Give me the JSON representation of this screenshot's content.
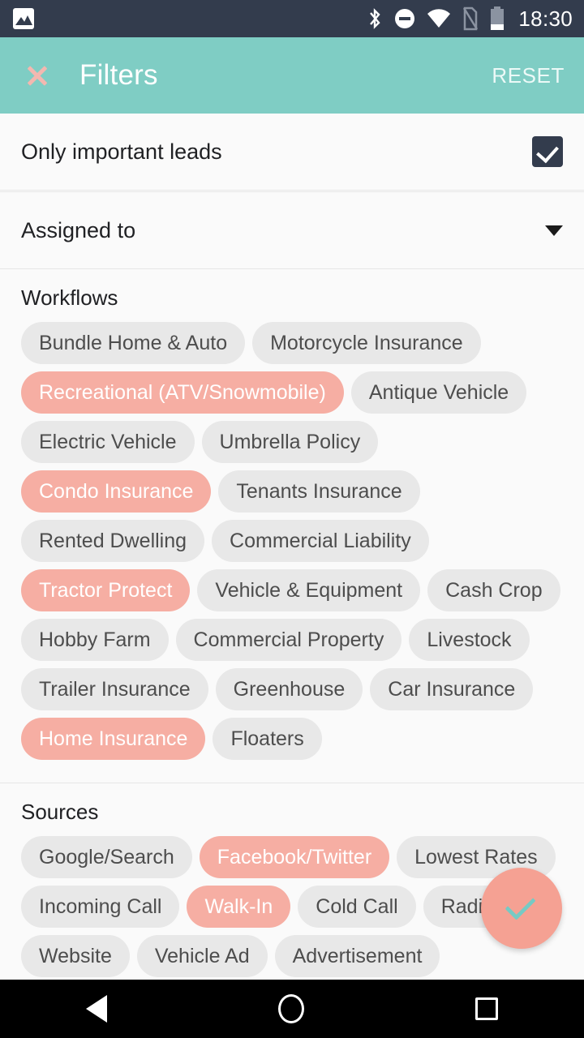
{
  "status_bar": {
    "time": "18:30",
    "icons": [
      "image-notification-icon",
      "bluetooth-icon",
      "do-not-disturb-icon",
      "wifi-icon",
      "no-sim-icon",
      "battery-icon"
    ]
  },
  "header": {
    "title": "Filters",
    "close_label": "close-icon",
    "reset_label": "RESET",
    "background_color": "#7fcdc4"
  },
  "important_leads": {
    "label": "Only important leads",
    "checked": true
  },
  "assigned_to": {
    "label": "Assigned to",
    "value": ""
  },
  "workflows": {
    "title": "Workflows",
    "chips": [
      {
        "label": "Bundle Home & Auto",
        "selected": false
      },
      {
        "label": "Motorcycle Insurance",
        "selected": false
      },
      {
        "label": "Recreational (ATV/Snowmobile)",
        "selected": true
      },
      {
        "label": "Antique Vehicle",
        "selected": false
      },
      {
        "label": "Electric Vehicle",
        "selected": false
      },
      {
        "label": "Umbrella Policy",
        "selected": false
      },
      {
        "label": "Condo Insurance",
        "selected": true
      },
      {
        "label": "Tenants Insurance",
        "selected": false
      },
      {
        "label": "Rented Dwelling",
        "selected": false
      },
      {
        "label": "Commercial Liability",
        "selected": false
      },
      {
        "label": "Tractor Protect",
        "selected": true
      },
      {
        "label": "Vehicle & Equipment",
        "selected": false
      },
      {
        "label": "Cash Crop",
        "selected": false
      },
      {
        "label": "Hobby Farm",
        "selected": false
      },
      {
        "label": "Commercial Property",
        "selected": false
      },
      {
        "label": "Livestock",
        "selected": false
      },
      {
        "label": "Trailer Insurance",
        "selected": false
      },
      {
        "label": "Greenhouse",
        "selected": false
      },
      {
        "label": "Car Insurance",
        "selected": false
      },
      {
        "label": "Home Insurance",
        "selected": true
      },
      {
        "label": "Floaters",
        "selected": false
      }
    ]
  },
  "sources": {
    "title": "Sources",
    "chips": [
      {
        "label": "Google/Search",
        "selected": false
      },
      {
        "label": "Facebook/Twitter",
        "selected": true
      },
      {
        "label": "Lowest Rates",
        "selected": false
      },
      {
        "label": "Incoming Call",
        "selected": false
      },
      {
        "label": "Walk-In",
        "selected": true
      },
      {
        "label": "Cold Call",
        "selected": false
      },
      {
        "label": "Radio",
        "selected": false
      },
      {
        "label": "Website",
        "selected": false
      },
      {
        "label": "Vehicle Ad",
        "selected": false
      },
      {
        "label": "Advertisement",
        "selected": false
      }
    ]
  },
  "apply_button": {
    "icon": "check-icon",
    "background_color": "#f5a193",
    "icon_color": "#76cac4"
  },
  "nav_bar": {
    "back": "back-icon",
    "home": "home-icon",
    "recents": "recents-icon"
  },
  "colors": {
    "accent_teal": "#7fcdc4",
    "chip_selected": "#f6aea3",
    "chip_unselected": "#e8e8e8",
    "status_bar": "#333c4d"
  }
}
